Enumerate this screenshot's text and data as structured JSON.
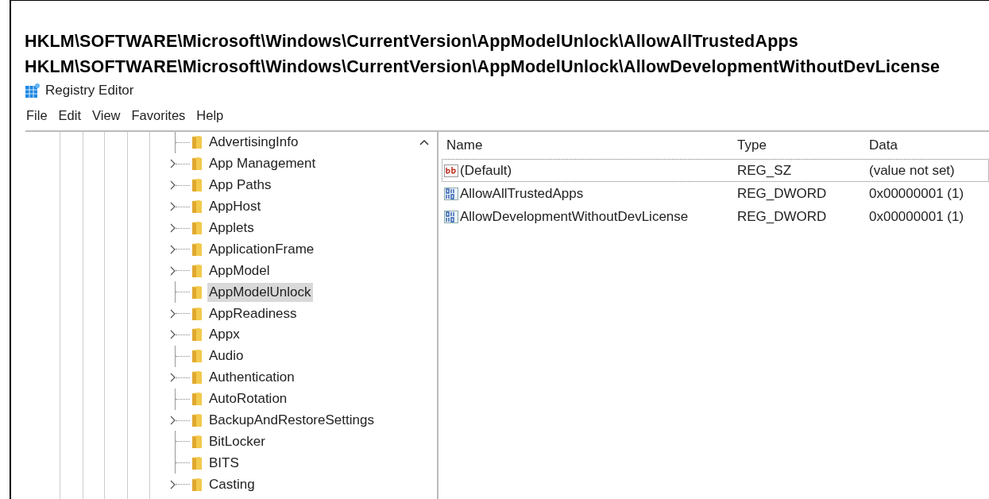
{
  "paths": [
    "HKLM\\SOFTWARE\\Microsoft\\Windows\\CurrentVersion\\AppModelUnlock\\AllowAllTrustedApps",
    "HKLM\\SOFTWARE\\Microsoft\\Windows\\CurrentVersion\\AppModelUnlock\\AllowDevelopmentWithoutDevLicense"
  ],
  "window": {
    "title": "Registry Editor"
  },
  "menu": [
    "File",
    "Edit",
    "View",
    "Favorites",
    "Help"
  ],
  "tree": {
    "items": [
      {
        "label": "AdvertisingInfo",
        "expandable": false,
        "selected": false
      },
      {
        "label": "App Management",
        "expandable": true,
        "selected": false
      },
      {
        "label": "App Paths",
        "expandable": true,
        "selected": false
      },
      {
        "label": "AppHost",
        "expandable": true,
        "selected": false
      },
      {
        "label": "Applets",
        "expandable": true,
        "selected": false
      },
      {
        "label": "ApplicationFrame",
        "expandable": true,
        "selected": false
      },
      {
        "label": "AppModel",
        "expandable": true,
        "selected": false
      },
      {
        "label": "AppModelUnlock",
        "expandable": false,
        "selected": true
      },
      {
        "label": "AppReadiness",
        "expandable": true,
        "selected": false
      },
      {
        "label": "Appx",
        "expandable": true,
        "selected": false
      },
      {
        "label": "Audio",
        "expandable": false,
        "selected": false
      },
      {
        "label": "Authentication",
        "expandable": true,
        "selected": false
      },
      {
        "label": "AutoRotation",
        "expandable": false,
        "selected": false
      },
      {
        "label": "BackupAndRestoreSettings",
        "expandable": true,
        "selected": false
      },
      {
        "label": "BitLocker",
        "expandable": false,
        "selected": false
      },
      {
        "label": "BITS",
        "expandable": false,
        "selected": false
      },
      {
        "label": "Casting",
        "expandable": true,
        "selected": false
      }
    ]
  },
  "values": {
    "columns": [
      "Name",
      "Type",
      "Data"
    ],
    "rows": [
      {
        "kind": "string",
        "name": "(Default)",
        "type": "REG_SZ",
        "data": "(value not set)",
        "selected": true
      },
      {
        "kind": "binary",
        "name": "AllowAllTrustedApps",
        "type": "REG_DWORD",
        "data": "0x00000001 (1)",
        "selected": false
      },
      {
        "kind": "binary",
        "name": "AllowDevelopmentWithoutDevLicense",
        "type": "REG_DWORD",
        "data": "0x00000001 (1)",
        "selected": false
      }
    ]
  }
}
